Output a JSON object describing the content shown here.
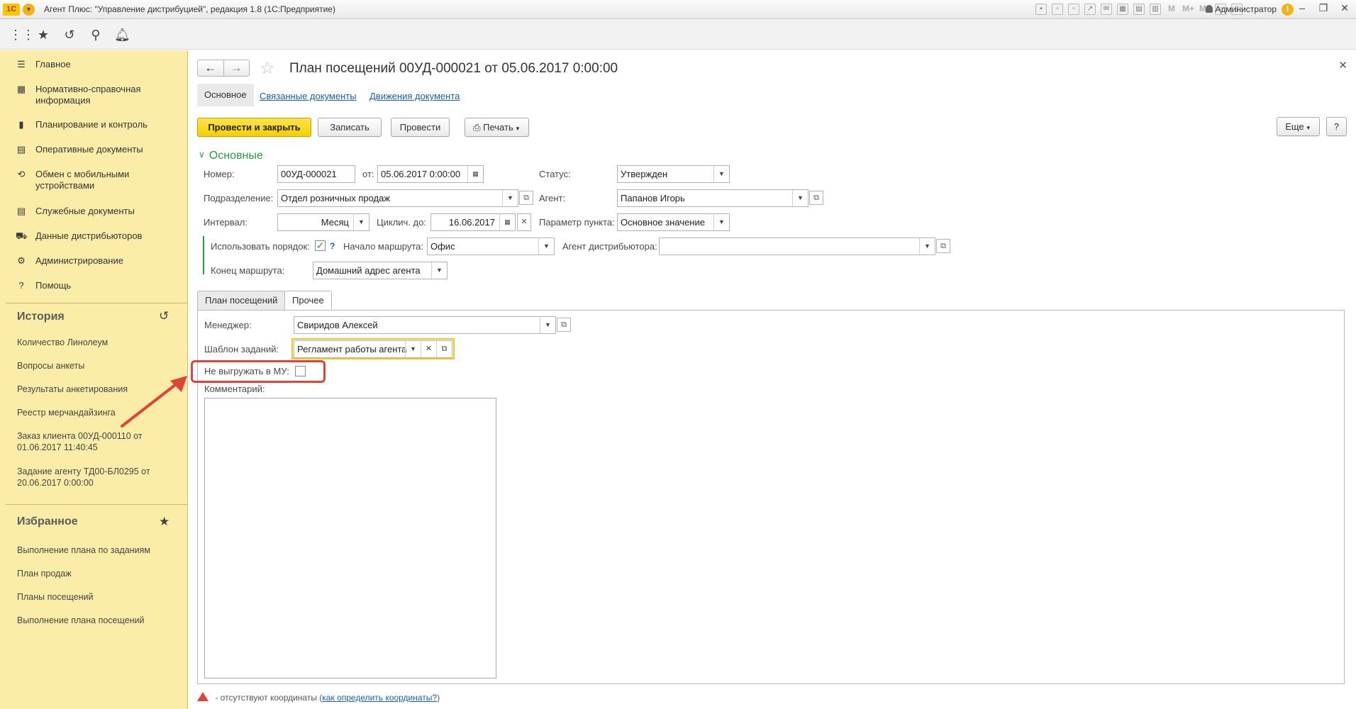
{
  "window": {
    "title": "Агент Плюс: \"Управление дистрибуцией\", редакция 1.8  (1С:Предприятие)",
    "user": "Администратор",
    "logo": "1C"
  },
  "sidebar": {
    "items": [
      {
        "label": "Главное",
        "icon": "menu-icon"
      },
      {
        "label": "Нормативно-справочная информация",
        "icon": "grid-icon"
      },
      {
        "label": "Планирование и контроль",
        "icon": "chart-icon"
      },
      {
        "label": "Оперативные документы",
        "icon": "docs-icon"
      },
      {
        "label": "Обмен с мобильными устройствами",
        "icon": "sync-icon"
      },
      {
        "label": "Служебные документы",
        "icon": "docs-icon"
      },
      {
        "label": "Данные дистрибьюторов",
        "icon": "truck-icon"
      },
      {
        "label": "Администрирование",
        "icon": "gear-icon"
      },
      {
        "label": "Помощь",
        "icon": "help-icon"
      }
    ],
    "history_title": "История",
    "history": [
      "Количество Линолеум",
      "Вопросы анкеты",
      "Результаты анкетирования",
      "Реестр мерчандайзинга",
      "Заказ клиента 00УД-000110 от 01.06.2017 11:40:45",
      "Задание агенту ТД00-БЛ0295 от 20.06.2017 0:00:00"
    ],
    "favorites_title": "Избранное",
    "favorites": [
      "Выполнение плана по заданиям",
      "План продаж",
      "Планы посещений",
      "Выполнение плана посещений"
    ]
  },
  "doc": {
    "title": "План посещений 00УД-000021 от 05.06.2017 0:00:00",
    "tabs": {
      "main": "Основное",
      "related": "Связанные документы",
      "movements": "Движения документа"
    },
    "buttons": {
      "post_close": "Провести и закрыть",
      "save": "Записать",
      "post": "Провести",
      "print": "Печать",
      "more": "Еще",
      "help": "?"
    },
    "group": "Основные",
    "fields": {
      "number_label": "Номер:",
      "number": "00УД-000021",
      "date_label": "от:",
      "date": "05.06.2017  0:00:00",
      "status_label": "Статус:",
      "status": "Утвержден",
      "division_label": "Подразделение:",
      "division": "Отдел розничных продаж",
      "agent_label": "Агент:",
      "agent": "Папанов Игорь",
      "interval_label": "Интервал:",
      "interval": "Месяц",
      "cyclic_label": "Циклич. до:",
      "cyclic": "16.06.2017",
      "param_label": "Параметр пункта:",
      "param": "Основное значение",
      "use_order_label": "Использовать порядок:",
      "use_order_checked": true,
      "use_order_hint": "?",
      "route_start_label": "Начало маршрута:",
      "route_start": "Офис",
      "dist_agent_label": "Агент дистрибьютора:",
      "dist_agent": "",
      "route_end_label": "Конец маршрута:",
      "route_end": "Домашний адрес агента"
    },
    "page_tabs": {
      "plan": "План посещений",
      "other": "Прочее"
    },
    "other": {
      "manager_label": "Менеджер:",
      "manager": "Свиридов Алексей",
      "template_label": "Шаблон заданий:",
      "template": "Регламент работы агента",
      "no_upload_label": "Не выгружать в МУ:",
      "no_upload_checked": false,
      "comment_label": "Комментарий:",
      "comment": ""
    },
    "footnote": {
      "text": " - отсутствуют координаты (",
      "link": "как определить координаты?",
      "tail": ")"
    }
  },
  "colors": {
    "sidebar": "#fbeda8",
    "primary_button": "#f5cf00",
    "accent_green": "#2d9a4a",
    "highlight_red": "#e0433a",
    "link": "#1c5fa3"
  }
}
